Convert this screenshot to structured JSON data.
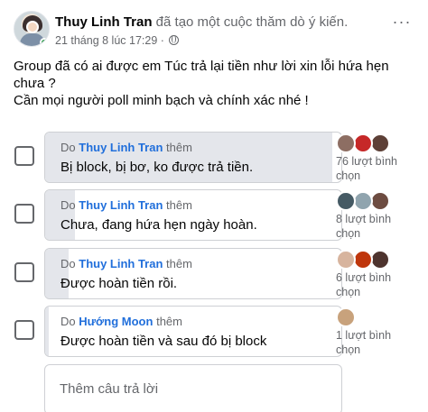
{
  "post": {
    "author": "Thuy Linh Tran",
    "action": "đã tạo một cuộc thăm dò ý kiến.",
    "timestamp": "21 tháng 8 lúc 17:29",
    "separator": "·",
    "more": "···",
    "body_line1": "Group đã có ai được em Túc trả lại tiền như lời xin lỗi hứa hẹn chưa ?",
    "body_line2": "Cần mọi người poll minh bạch và chính xác nhé !"
  },
  "poll": {
    "options": [
      {
        "by_prefix": "Do",
        "by_name": "Thuy Linh Tran",
        "by_suffix": "thêm",
        "label": "Bị block, bị bơ, ko được trả tiền.",
        "votes": "76 lượt bình chọn",
        "vote_fraction": 0.97,
        "faces": [
          "#8d6e63",
          "#c62828",
          "#5d4037"
        ]
      },
      {
        "by_prefix": "Do",
        "by_name": "Thuy Linh Tran",
        "by_suffix": "thêm",
        "label": "Chưa, đang hứa hẹn ngày hoàn.",
        "votes": "8 lượt bình chọn",
        "vote_fraction": 0.1,
        "faces": [
          "#455a64",
          "#90a4ae",
          "#6d4c41"
        ]
      },
      {
        "by_prefix": "Do",
        "by_name": "Thuy Linh Tran",
        "by_suffix": "thêm",
        "label": "Được hoàn tiền rồi.",
        "votes": "6 lượt bình chọn",
        "vote_fraction": 0.08,
        "faces": [
          "#d7b49e",
          "#bf360c",
          "#4e342e"
        ]
      },
      {
        "by_prefix": "Do",
        "by_name": "Hướng Moon",
        "by_suffix": "thêm",
        "label": "Được hoàn tiền và sau đó bị block",
        "votes": "1 lượt bình chọn",
        "vote_fraction": 0.013,
        "faces": [
          "#c8a27c"
        ]
      }
    ],
    "add_placeholder": "Thêm câu trả lời"
  }
}
